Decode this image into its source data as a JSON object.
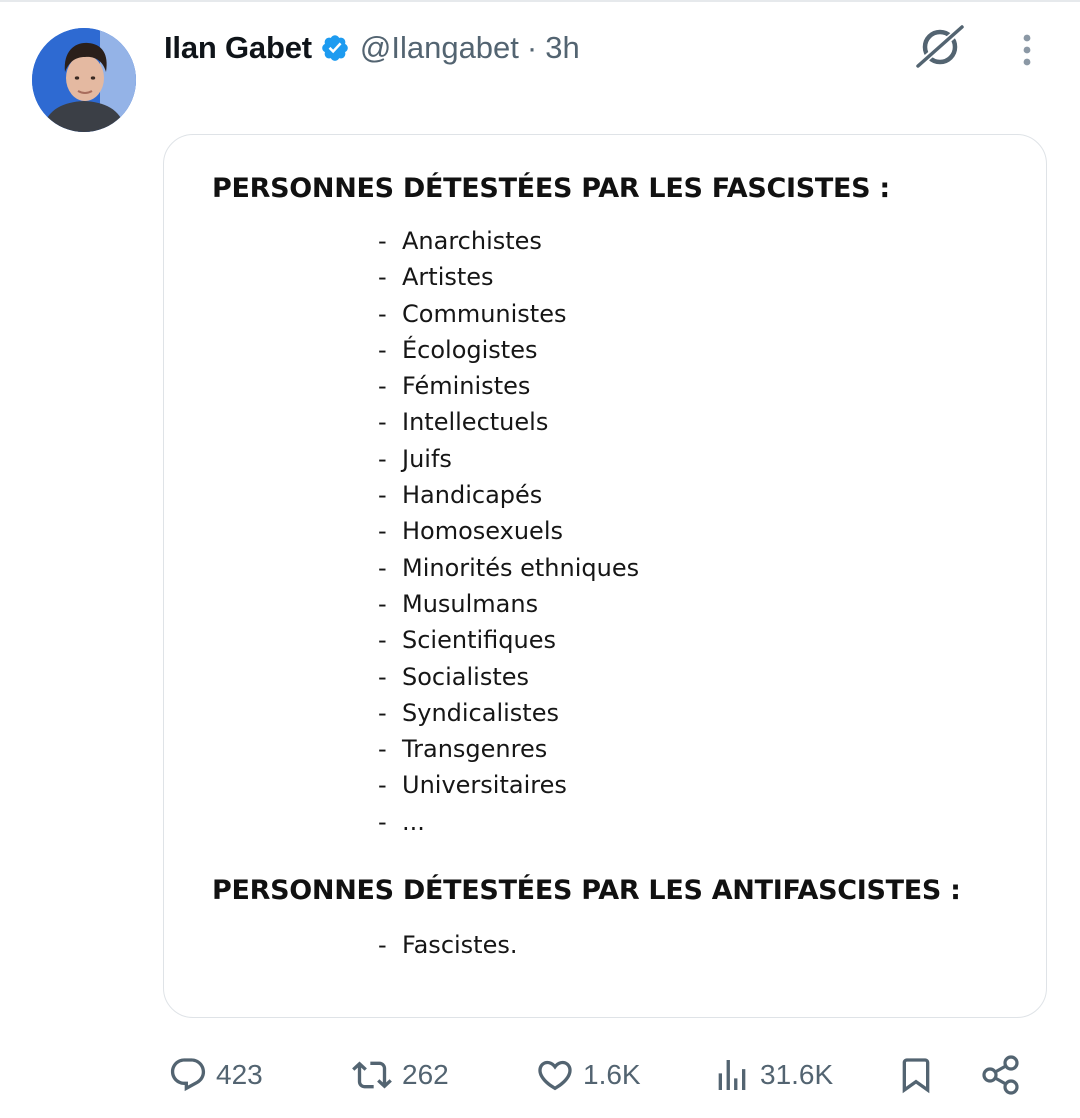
{
  "tweet": {
    "author": {
      "display_name": "Ilan Gabet",
      "handle": "@Ilangabet",
      "verified": true
    },
    "separator": "·",
    "time": "3h"
  },
  "media": {
    "heading_1": "PERSONNES DÉTESTÉES PAR LES FASCISTES :",
    "list_1": [
      "Anarchistes",
      "Artistes",
      "Communistes",
      "Écologistes",
      "Féministes",
      "Intellectuels",
      "Juifs",
      "Handicapés",
      "Homosexuels",
      "Minorités ethniques",
      "Musulmans",
      "Scientifiques",
      "Socialistes",
      "Syndicalistes",
      "Transgenres",
      "Universitaires",
      "..."
    ],
    "heading_2": "PERSONNES DÉTESTÉES PAR LES ANTIFASCISTES :",
    "list_2": [
      "Fascistes."
    ],
    "bullet": "-"
  },
  "actions": {
    "replies": "423",
    "reposts": "262",
    "likes": "1.6K",
    "views": "31.6K"
  },
  "icons": {
    "reply": "reply-icon",
    "repost": "repost-icon",
    "like": "heart-icon",
    "views": "views-icon",
    "bookmark": "bookmark-icon",
    "share": "share-icon",
    "grok": "grok-icon",
    "more": "more-icon",
    "verified": "verified-badge-icon"
  },
  "colors": {
    "text": "#0f1419",
    "secondary": "#536471",
    "verified": "#1d9bf0",
    "border": "#dfe3e7"
  }
}
